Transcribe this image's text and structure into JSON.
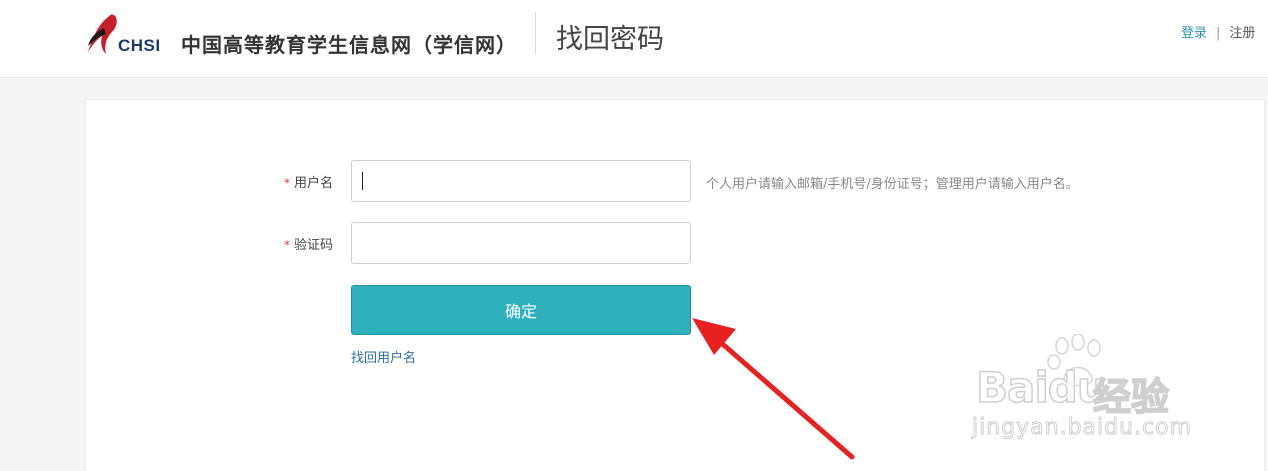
{
  "header": {
    "logo_text": "CHSI",
    "site_name": "中国高等教育学生信息网（学信网）",
    "page_title": "找回密码",
    "login_label": "登录",
    "separator": "|",
    "register_label": "注册"
  },
  "form": {
    "username": {
      "required_mark": "*",
      "label": "用户名",
      "value": "",
      "hint": "个人用户请输入邮箱/手机号/身份证号；管理用户请输入用户名。"
    },
    "captcha": {
      "required_mark": "*",
      "label": "验证码",
      "value": ""
    },
    "submit_label": "确定",
    "recover_username_link": "找回用户名"
  },
  "watermark": {
    "brand": "Baidu",
    "brand_suffix": "经验",
    "url": "jingyan.baidu.com"
  },
  "colors": {
    "accent": "#2fb1bd",
    "link": "#2d95b3",
    "required": "#e4393c",
    "annotation_arrow": "#e8201f"
  }
}
